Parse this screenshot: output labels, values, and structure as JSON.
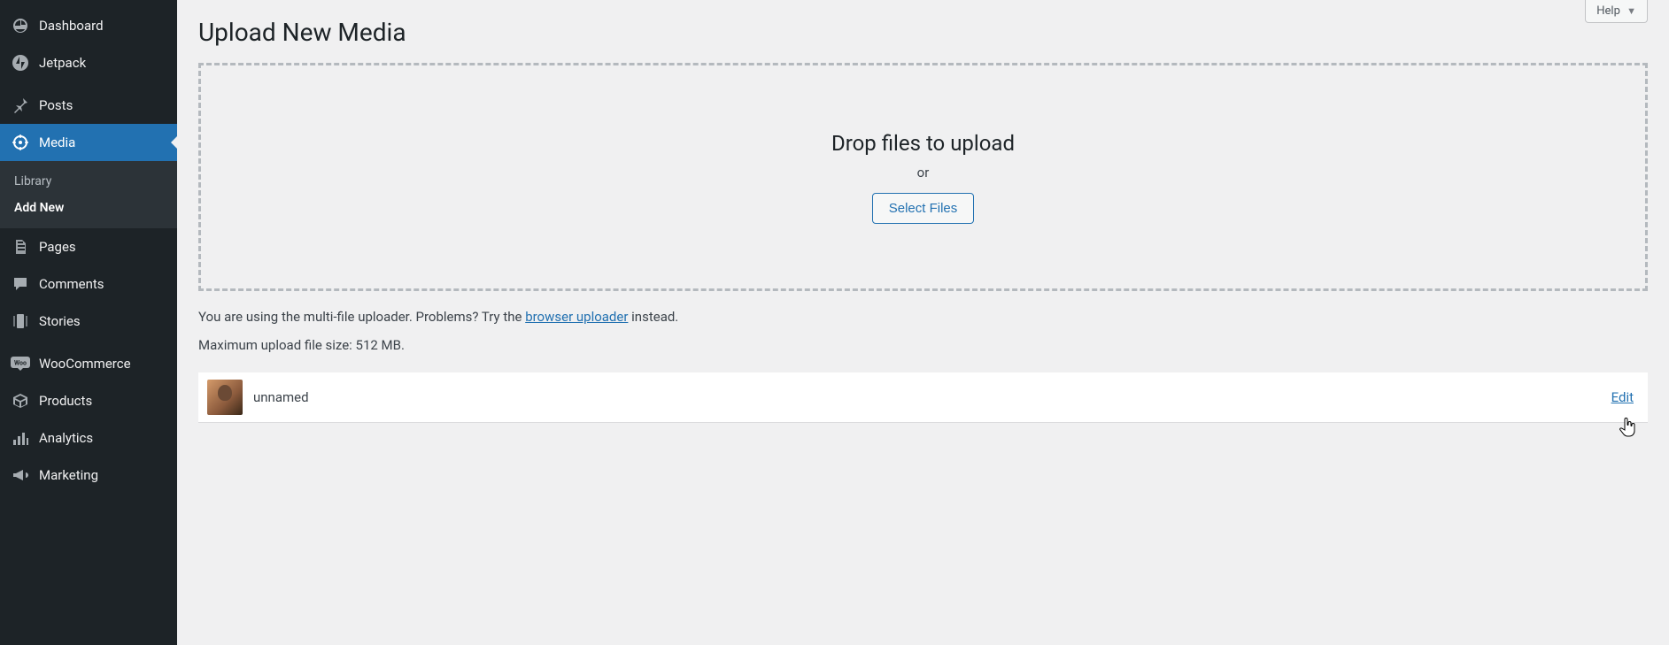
{
  "sidebar": {
    "items": [
      {
        "label": "Dashboard"
      },
      {
        "label": "Jetpack"
      },
      {
        "label": "Posts"
      },
      {
        "label": "Media"
      },
      {
        "label": "Pages"
      },
      {
        "label": "Comments"
      },
      {
        "label": "Stories"
      },
      {
        "label": "WooCommerce"
      },
      {
        "label": "Products"
      },
      {
        "label": "Analytics"
      },
      {
        "label": "Marketing"
      }
    ],
    "submenu": {
      "library": "Library",
      "add_new": "Add New"
    }
  },
  "header": {
    "help": "Help"
  },
  "page": {
    "title": "Upload New Media"
  },
  "uploader": {
    "drop_text": "Drop files to upload",
    "or_text": "or",
    "select_files": "Select Files",
    "helper_prefix": "You are using the multi-file uploader. Problems? Try the ",
    "browser_uploader": "browser uploader",
    "helper_suffix": " instead.",
    "max_upload": "Maximum upload file size: 512 MB."
  },
  "uploaded": {
    "name": "unnamed",
    "edit": "Edit"
  }
}
